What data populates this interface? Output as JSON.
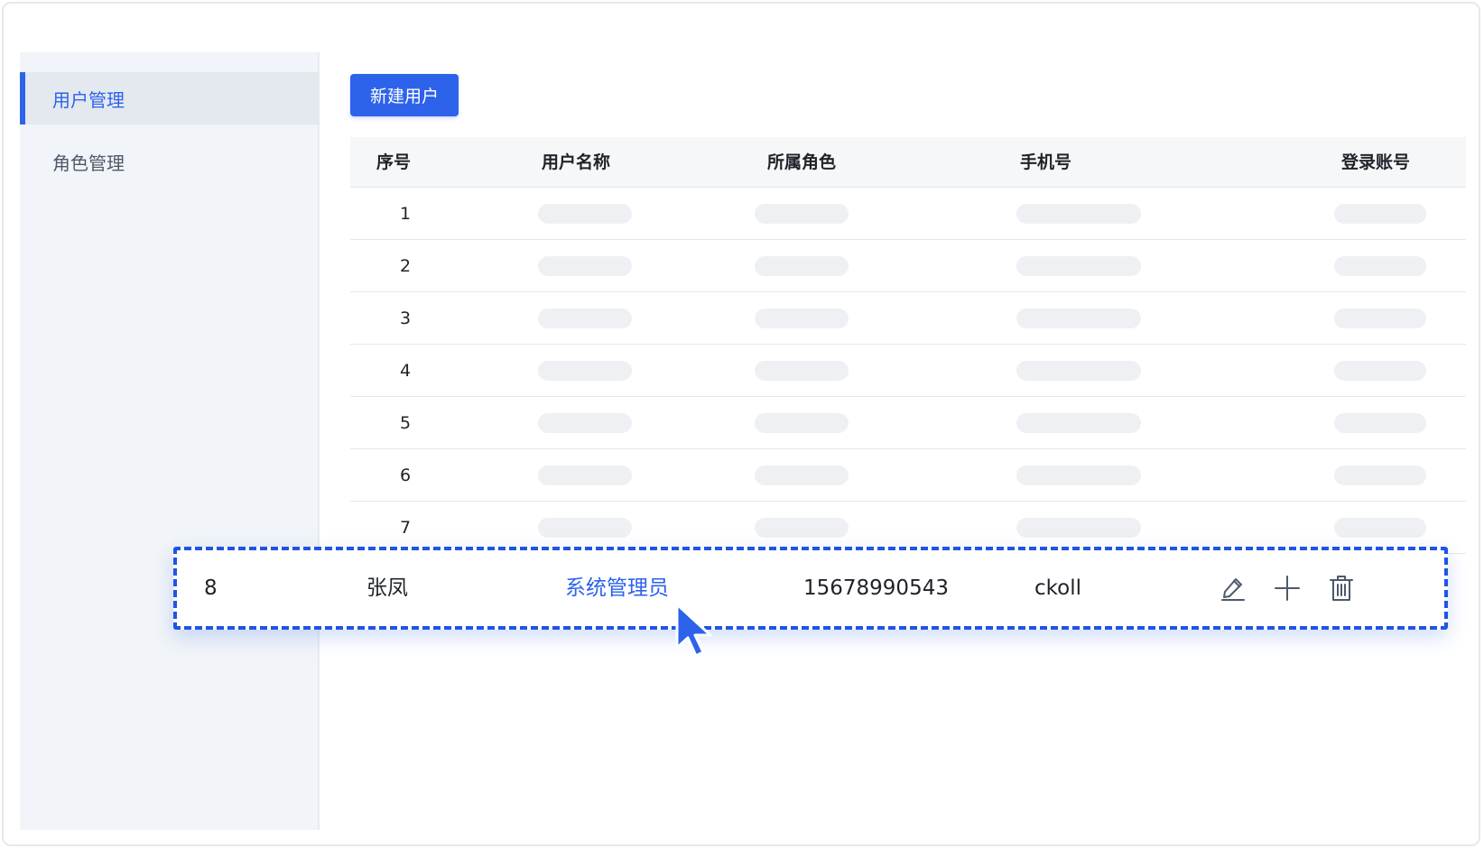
{
  "sidebar": {
    "items": [
      {
        "label": "用户管理",
        "active": true
      },
      {
        "label": "角色管理",
        "active": false
      }
    ]
  },
  "toolbar": {
    "new_user_label": "新建用户"
  },
  "table": {
    "columns": [
      "序号",
      "用户名称",
      "所属角色",
      "手机号",
      "登录账号"
    ],
    "rows": [
      {
        "index": "1"
      },
      {
        "index": "2"
      },
      {
        "index": "3"
      },
      {
        "index": "4"
      },
      {
        "index": "5"
      },
      {
        "index": "6"
      },
      {
        "index": "7"
      }
    ]
  },
  "highlighted_row": {
    "index": "8",
    "name": "张凤",
    "role": "系统管理员",
    "phone": "15678990543",
    "account": "ckoll",
    "actions": [
      "edit-icon",
      "plus-icon",
      "trash-icon"
    ]
  },
  "colors": {
    "accent": "#2d63ea",
    "sidebar_bg": "#f1f4f8",
    "placeholder": "#eef0f3"
  }
}
